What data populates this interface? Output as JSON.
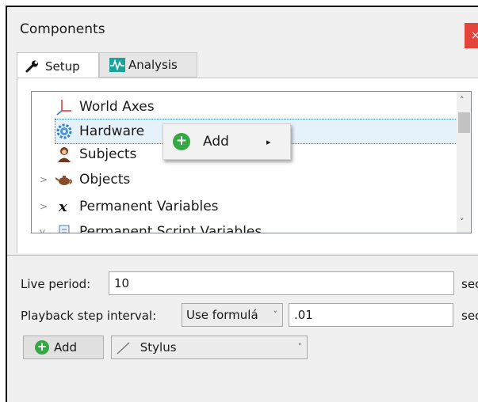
{
  "window": {
    "title": "Components",
    "close_glyph": "×"
  },
  "tabs": [
    {
      "label": "Setup",
      "icon": "wrench-icon"
    },
    {
      "label": "Analysis",
      "icon": "waveform-icon"
    }
  ],
  "tree": {
    "items": [
      {
        "label": "World Axes",
        "icon": "axes-icon",
        "expander": ""
      },
      {
        "label": "Hardware",
        "icon": "gear-icon",
        "expander": ""
      },
      {
        "label": "Subjects",
        "icon": "person-icon",
        "expander": ""
      },
      {
        "label": "Objects",
        "icon": "teapot-icon",
        "expander": ">"
      },
      {
        "label": "Permanent Variables",
        "icon": "variable-x-icon",
        "expander": ">"
      },
      {
        "label": "Permanent Script Variables",
        "icon": "script-icon",
        "expander": "v"
      }
    ]
  },
  "context_menu": {
    "item_label": "Add",
    "submenu_glyph": "▸"
  },
  "live_period": {
    "label": "Live period:",
    "value": "10",
    "unit": "sec"
  },
  "playback": {
    "label": "Playback step interval:",
    "mode": "Use formulá",
    "value": ".01",
    "unit": "sec"
  },
  "bottom": {
    "add_label": "Add",
    "tool_label": "Stylus"
  }
}
